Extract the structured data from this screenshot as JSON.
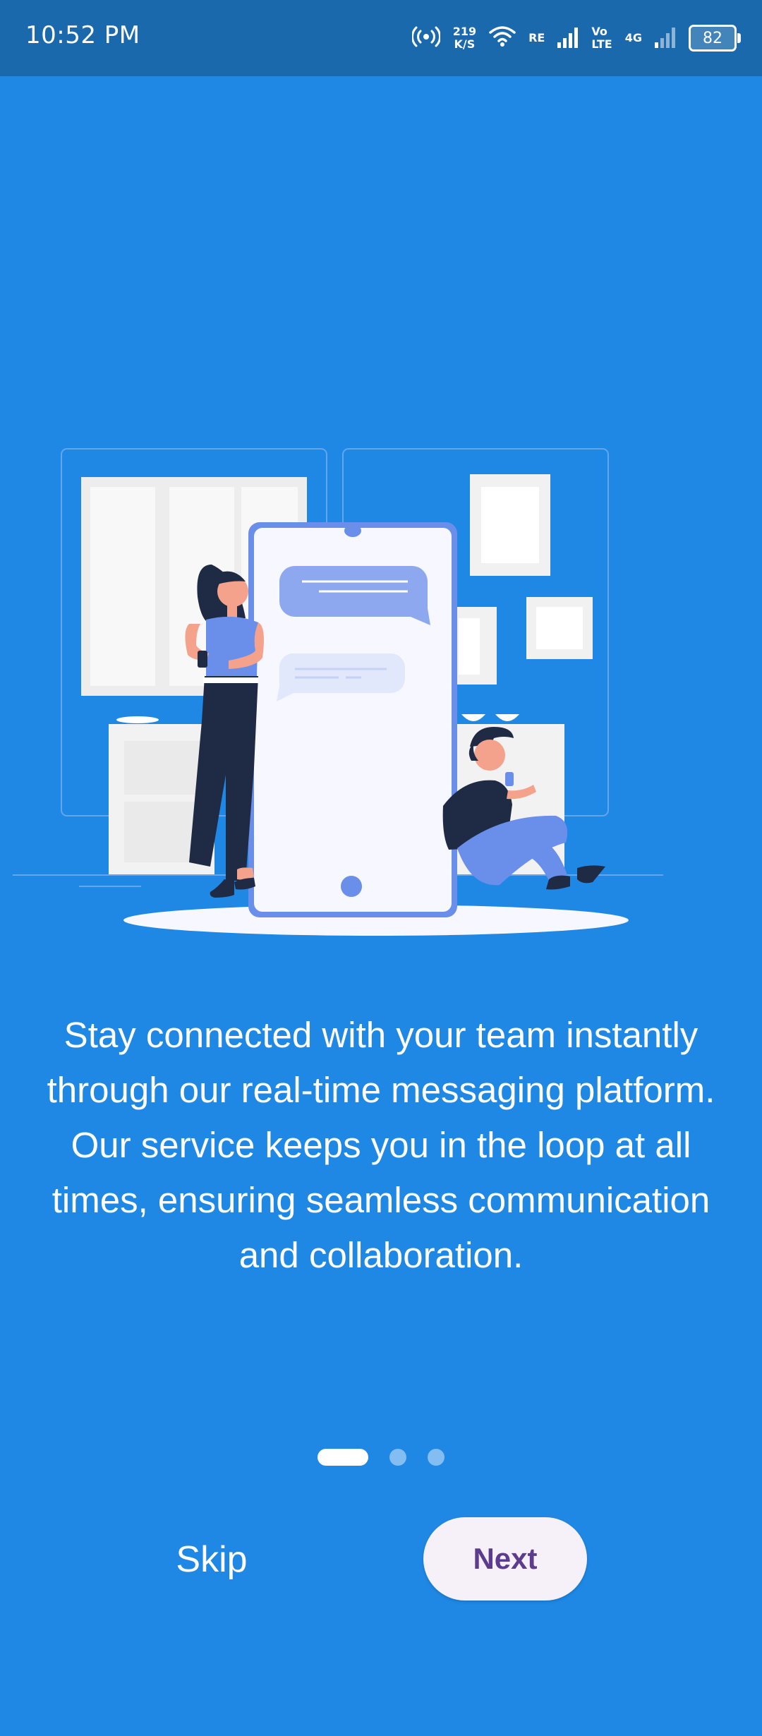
{
  "status_bar": {
    "time": "10:52 PM",
    "speed_value": "219",
    "speed_unit": "K/S",
    "network1": "RE",
    "network2_top": "Vo",
    "network2_bottom": "LTE",
    "network3": "4G",
    "battery_level": "82",
    "icons": [
      "hotspot-icon",
      "wifi-icon",
      "signal-icon",
      "signal-icon",
      "battery-icon"
    ]
  },
  "onboarding": {
    "description": "Stay connected with your team instantly through our real-time messaging platform. Our service keeps you in the loop at all times, ensuring seamless communication and collaboration.",
    "page_indicator": {
      "total": 3,
      "active_index": 0
    },
    "skip_label": "Skip",
    "next_label": "Next"
  },
  "colors": {
    "background": "#1F88E5",
    "status_bar": "#1A69AD",
    "next_button_bg": "#F6F1F8",
    "next_button_text": "#5D3C8F"
  }
}
